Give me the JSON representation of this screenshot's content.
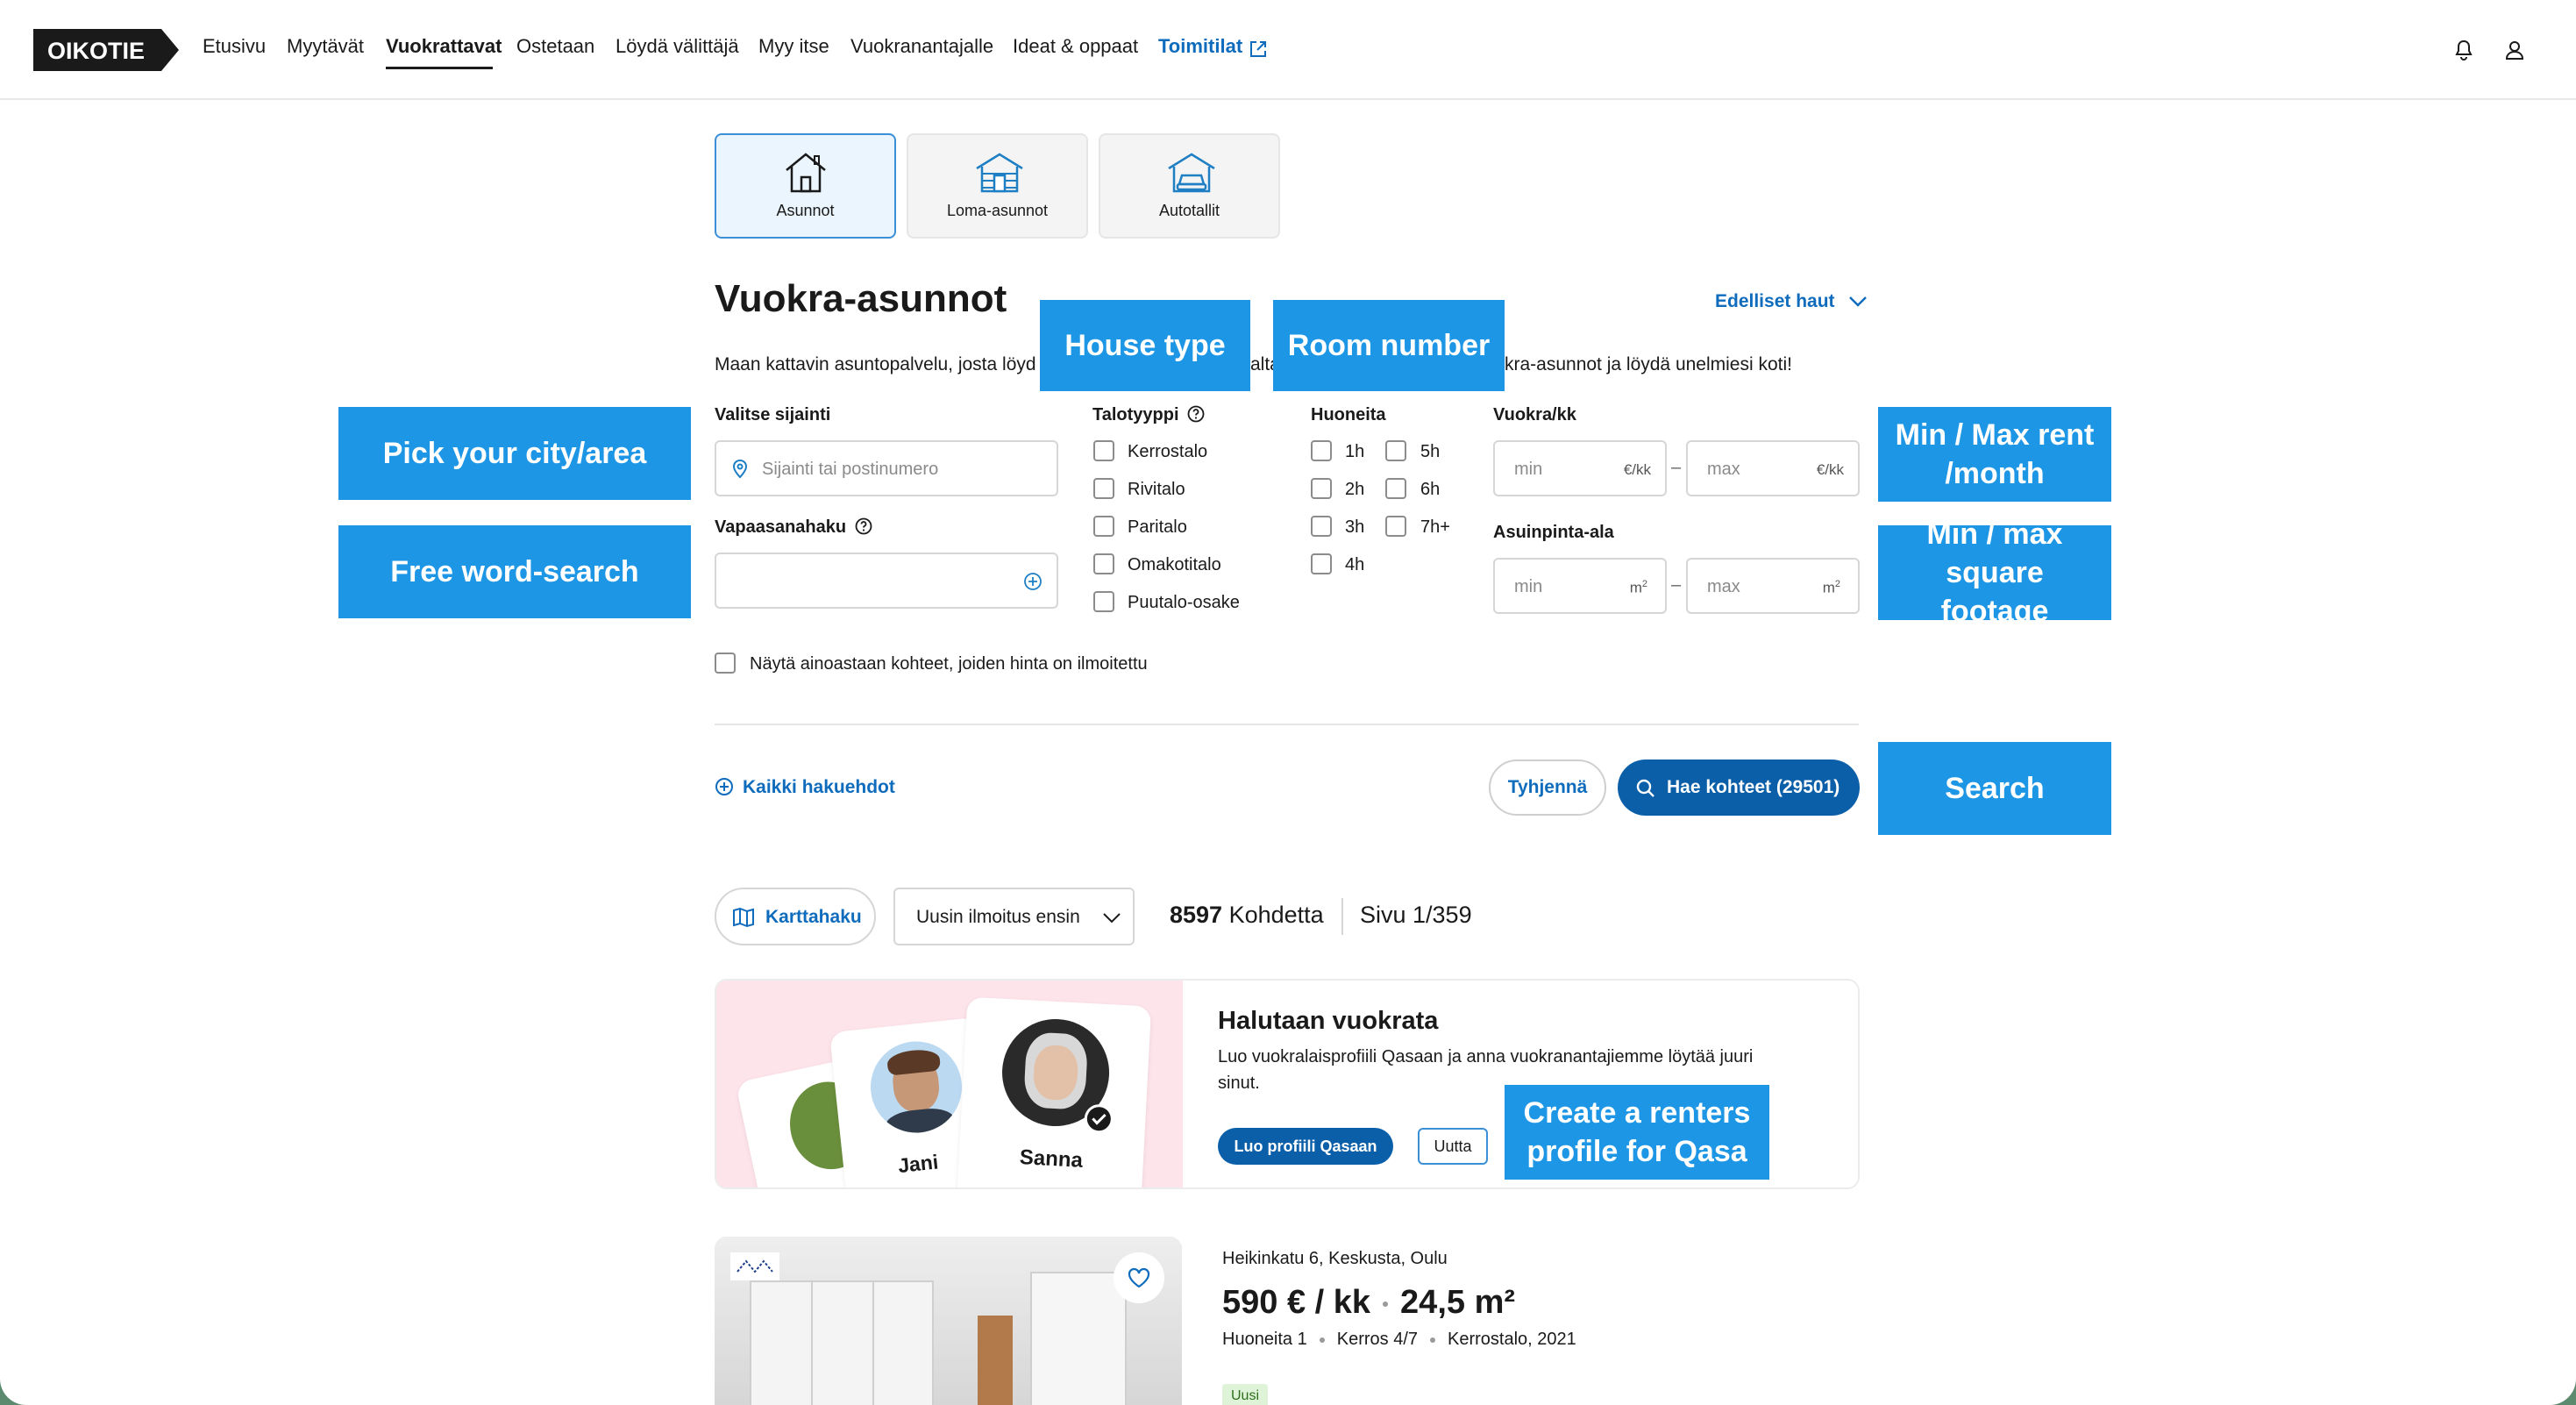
{
  "header": {
    "logo_text": "OIKOTIE",
    "nav": [
      {
        "label": "Etusivu"
      },
      {
        "label": "Myytävät"
      },
      {
        "label": "Vuokrattavat"
      },
      {
        "label": "Ostetaan"
      },
      {
        "label": "Löydä välittäjä"
      },
      {
        "label": "Myy itse"
      },
      {
        "label": "Vuokranantajalle"
      },
      {
        "label": "Ideat & oppaat"
      },
      {
        "label": "Toimitilat"
      }
    ],
    "active_nav": "Vuokrattavat",
    "icons": [
      "bell-icon",
      "user-icon"
    ]
  },
  "types": [
    {
      "label": "Asunnot",
      "active": true
    },
    {
      "label": "Loma-asunnot",
      "active": false
    },
    {
      "label": "Autotallit",
      "active": false
    }
  ],
  "page": {
    "title": "Vuokra-asunnot",
    "previous_searches": "Edelliset haut",
    "intro_left": "Maan kattavin asuntopalvelu, josta löyd",
    "intro_mid": "alta",
    "intro_right": "kra-asunnot ja löydä unelmiesi koti!"
  },
  "filters": {
    "location": {
      "label": "Valitse sijainti",
      "placeholder": "Sijainti tai postinumero"
    },
    "freeword": {
      "label": "Vapaasanahaku",
      "value": ""
    },
    "house_type": {
      "label": "Talotyyppi",
      "options": [
        "Kerrostalo",
        "Rivitalo",
        "Paritalo",
        "Omakotitalo",
        "Puutalo-osake"
      ]
    },
    "rooms": {
      "label": "Huoneita",
      "options": [
        "1h",
        "2h",
        "3h",
        "4h",
        "5h",
        "6h",
        "7h+"
      ]
    },
    "rent": {
      "label": "Vuokra/kk",
      "min_placeholder": "min",
      "max_placeholder": "max",
      "unit": "€/kk"
    },
    "area": {
      "label": "Asuinpinta-ala",
      "min_placeholder": "min",
      "max_placeholder": "max",
      "unit": "m",
      "unit_sup": "2"
    },
    "price_only": "Näytä ainoastaan kohteet, joiden hinta on ilmoitettu",
    "dash": "–"
  },
  "actions": {
    "all_criteria": "Kaikki hakuehdot",
    "clear": "Tyhjennä",
    "search": "Hae kohteet (29501)"
  },
  "results": {
    "map_search": "Karttahaku",
    "sort": "Uusin ilmoitus ensin",
    "count_number": "8597",
    "count_label": "Kohdetta",
    "page": "Sivu 1/359"
  },
  "promo": {
    "title": "Halutaan vuokrata",
    "text": "Luo vuokralaisprofiili Qasaan ja anna vuokranantajiemme löytää juuri sinut.",
    "button": "Luo profiili Qasaan",
    "badge": "Uutta",
    "names": [
      "Jani",
      "Sanna"
    ]
  },
  "listing": {
    "address": "Heikinkatu 6, Keskusta, Oulu",
    "price": "590 € / kk",
    "area": "24,5 m²",
    "rooms": "Huoneita 1",
    "floor": "Kerros 4/7",
    "type": "Kerrostalo, 2021",
    "badge": "Uusi"
  },
  "annotations": {
    "house_type": "House type",
    "room_number": "Room number",
    "city": "Pick your city/area",
    "freeword": "Free word-search",
    "rent": "Min / Max rent /month",
    "area": "Min / max square footage",
    "search": "Search",
    "renters": "Create a renters profile for Qasa"
  },
  "colors": {
    "brand_blue": "#0f6cbd",
    "primary_button": "#0a5fa8",
    "annotation": "#1e96e6",
    "promo_bg": "#fde4ea"
  }
}
